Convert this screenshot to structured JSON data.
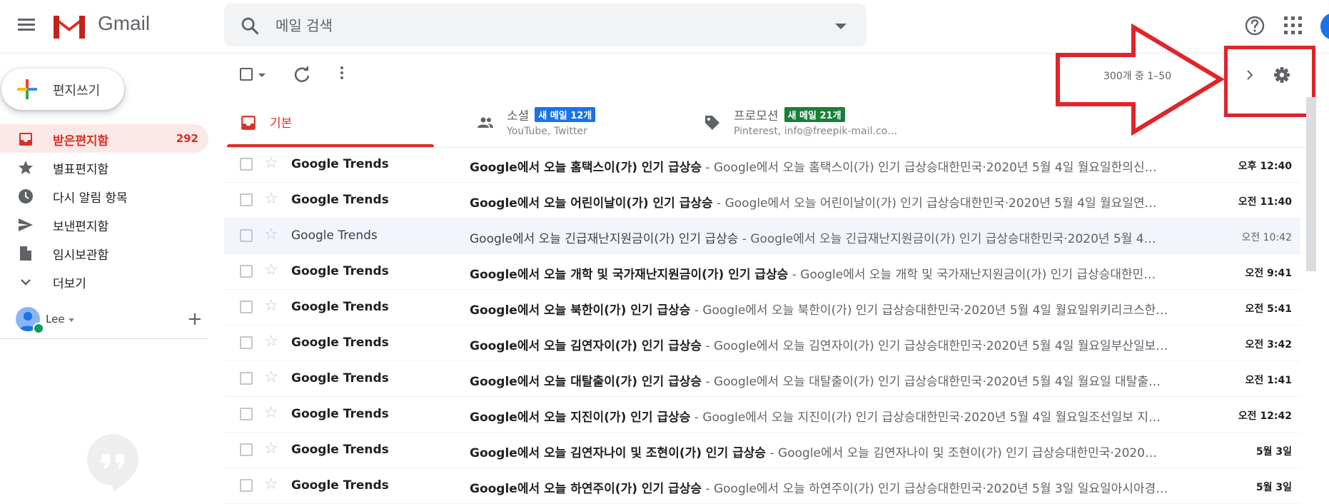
{
  "header": {
    "app_name": "Gmail",
    "search_placeholder": "메일 검색"
  },
  "sidebar": {
    "compose_label": "편지쓰기",
    "items": [
      {
        "label": "받은편지함",
        "count": "292",
        "icon": "inbox-icon",
        "active": true
      },
      {
        "label": "별표편지함",
        "icon": "star-icon"
      },
      {
        "label": "다시 알림 항목",
        "icon": "clock-icon"
      },
      {
        "label": "보낸편지함",
        "icon": "send-icon"
      },
      {
        "label": "임시보관함",
        "icon": "draft-icon"
      },
      {
        "label": "더보기",
        "icon": "chevron-down-icon"
      }
    ],
    "hangouts_user": "Lee"
  },
  "toolbar": {
    "pagination": "300개 중 1–50"
  },
  "tabs": [
    {
      "title": "기본",
      "icon": "inbox-icon",
      "active": true
    },
    {
      "title": "소셜",
      "badge": "새 메일 12개",
      "badge_color": "#1a73e8",
      "subtitle": "YouTube, Twitter",
      "icon": "people-icon"
    },
    {
      "title": "프로모션",
      "badge": "새 메일 21개",
      "badge_color": "#188038",
      "subtitle": "Pinterest, info@freepik-mail.co…",
      "icon": "tag-icon"
    }
  ],
  "emails": [
    {
      "sender": "Google Trends",
      "subject": "Google에서 오늘 홈택스이(가) 인기 급상승",
      "snippet": "Google에서 오늘 홈택스이(가) 인기 급상승대한민국·2020년 5월 4일 월요일한의신…",
      "date": "오후 12:40",
      "unread": true
    },
    {
      "sender": "Google Trends",
      "subject": "Google에서 오늘 어린이날이(가) 인기 급상승",
      "snippet": "Google에서 오늘 어린이날이(가) 인기 급상승대한민국·2020년 5월 4일 월요일연…",
      "date": "오전 11:40",
      "unread": true
    },
    {
      "sender": "Google Trends",
      "subject": "Google에서 오늘 긴급재난지원금이(가) 인기 급상승",
      "snippet": "Google에서 오늘 긴급재난지원금이(가) 인기 급상승대한민국·2020년 5월 4…",
      "date": "오전 10:42",
      "unread": false
    },
    {
      "sender": "Google Trends",
      "subject": "Google에서 오늘 개학 및 국가재난지원금이(가) 인기 급상승",
      "snippet": "Google에서 오늘 개학 및 국가재난지원금이(가) 인기 급상승대한민…",
      "date": "오전 9:41",
      "unread": true
    },
    {
      "sender": "Google Trends",
      "subject": "Google에서 오늘 북한이(가) 인기 급상승",
      "snippet": "Google에서 오늘 북한이(가) 인기 급상승대한민국·2020년 5월 4일 월요일위키리크스한…",
      "date": "오전 5:41",
      "unread": true
    },
    {
      "sender": "Google Trends",
      "subject": "Google에서 오늘 김연자이(가) 인기 급상승",
      "snippet": "Google에서 오늘 김연자이(가) 인기 급상승대한민국·2020년 5월 4일 월요일부산일보…",
      "date": "오전 3:42",
      "unread": true
    },
    {
      "sender": "Google Trends",
      "subject": "Google에서 오늘 대탈출이(가) 인기 급상승",
      "snippet": "Google에서 오늘 대탈출이(가) 인기 급상승대한민국·2020년 5월 4일 월요일 대탈출…",
      "date": "오전 1:41",
      "unread": true
    },
    {
      "sender": "Google Trends",
      "subject": "Google에서 오늘 지진이(가) 인기 급상승",
      "snippet": "Google에서 오늘 지진이(가) 인기 급상승대한민국·2020년 5월 4일 월요일조선일보 지…",
      "date": "오전 12:42",
      "unread": true
    },
    {
      "sender": "Google Trends",
      "subject": "Google에서 오늘 김연자나이 및 조현이(가) 인기 급상승",
      "snippet": "Google에서 오늘 김연자나이 및 조현이(가) 인기 급상승대한민국·2020…",
      "date": "5월 3일",
      "unread": true
    },
    {
      "sender": "Google Trends",
      "subject": "Google에서 오늘 하연주이(가) 인기 급상승",
      "snippet": "Google에서 오늘 하연주이(가) 인기 급상승대한민국·2020년 5월 3일 일요일아시아경…",
      "date": "5월 3일",
      "unread": true
    }
  ],
  "colors": {
    "accent": "#d93025",
    "annotation": "#e0242b"
  }
}
